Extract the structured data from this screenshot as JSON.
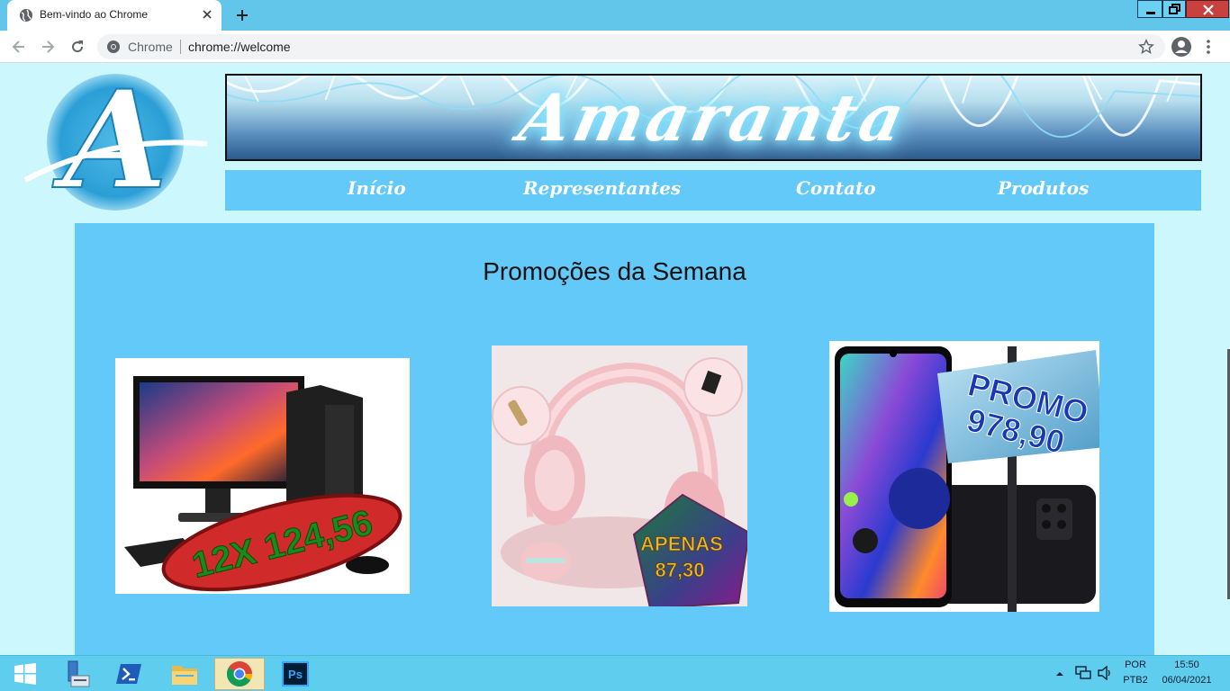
{
  "browser": {
    "tab_title": "Bem-vindo ao Chrome",
    "omnibox_chip": "Chrome",
    "url": "chrome://welcome"
  },
  "site": {
    "banner_title": "Amaranta",
    "logo_letter": "A",
    "nav": [
      "Início",
      "Representantes",
      "Contato",
      "Produtos"
    ],
    "promo_title": "Promoções da Semana",
    "products": [
      {
        "name": "desktop-computer",
        "price_text": "12X 124,56"
      },
      {
        "name": "pink-headphones",
        "price_label": "APENAS",
        "price_value": "87,30"
      },
      {
        "name": "smartphone",
        "price_label": "PROMO",
        "price_value": "978,90"
      }
    ]
  },
  "taskbar": {
    "language": "POR",
    "layout": "PTB2",
    "time": "15:50",
    "date": "06/04/2021"
  }
}
